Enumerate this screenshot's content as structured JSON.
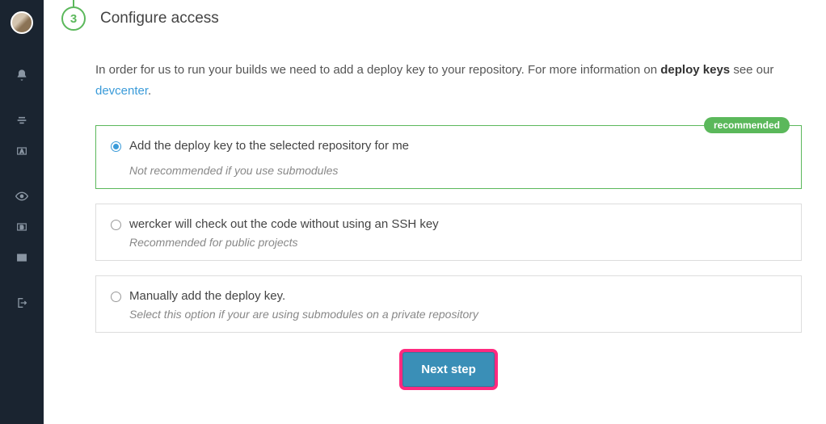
{
  "step": {
    "number": "3",
    "title": "Configure access"
  },
  "intro": {
    "prefix": "In order for us to run your builds we need to add a deploy key to your repository. For more information on ",
    "strong": "deploy keys",
    "mid": " see our ",
    "link": "devcenter",
    "suffix": "."
  },
  "options": [
    {
      "label": "Add the deploy key to the selected repository for me",
      "hint": "Not recommended if you use submodules",
      "badge": "recommended",
      "selected": true
    },
    {
      "label": "wercker will check out the code without using an SSH key",
      "hint": "Recommended for public projects",
      "selected": false
    },
    {
      "label": "Manually add the deploy key.",
      "hint": "Select this option if your are using submodules on a private repository",
      "selected": false
    }
  ],
  "action": {
    "next_label": "Next step"
  }
}
